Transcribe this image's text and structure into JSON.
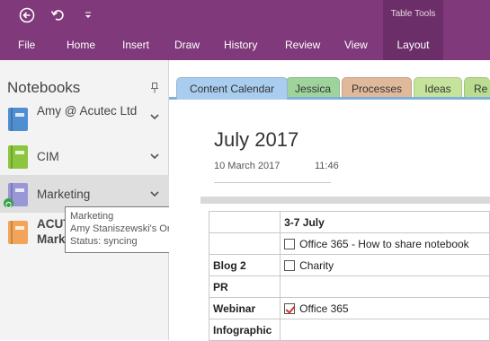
{
  "quick_access": {
    "back_icon": "back-circle-icon",
    "undo_icon": "undo-icon",
    "customize_icon": "customize-dropdown-icon"
  },
  "ribbon": {
    "color": "#80397b",
    "tabs": [
      {
        "label": "File"
      },
      {
        "label": "Home"
      },
      {
        "label": "Insert"
      },
      {
        "label": "Draw"
      },
      {
        "label": "History"
      },
      {
        "label": "Review"
      },
      {
        "label": "View"
      }
    ],
    "contextual_group": "Table Tools",
    "contextual_tab": "Layout"
  },
  "sidebar": {
    "header": "Notebooks",
    "pin_icon": "pin-icon",
    "notebooks": [
      {
        "label": "Amy @ Acutec Ltd",
        "color": "#4f8fd1"
      },
      {
        "label": "CIM",
        "color": "#8cc63e"
      },
      {
        "label": "Marketing",
        "color": "#9a97d9"
      },
      {
        "label": "ACUTEC Marketing",
        "color": "#f2a45a"
      }
    ],
    "tooltip": {
      "line1": "Marketing",
      "line2": "Amy Staniszewski's OneDrive » Documents",
      "line3": "Status: syncing"
    }
  },
  "section_tabs": [
    {
      "label": "Content Calendar",
      "color": "#a9cdee"
    },
    {
      "label": "Jessica",
      "color": "#9ed49c"
    },
    {
      "label": "Processes",
      "color": "#e0b99b"
    },
    {
      "label": "Ideas",
      "color": "#c5e39a"
    },
    {
      "label": "Re",
      "color": "#b9dc91"
    }
  ],
  "page": {
    "title": "July 2017",
    "date": "10 March 2017",
    "time": "11:46",
    "table": {
      "rows": [
        {
          "label": "",
          "value": "3-7 July",
          "bold_value": true,
          "checkbox": "none"
        },
        {
          "label": "",
          "value": "Office 365 - How to share notebook",
          "checkbox": "unchecked"
        },
        {
          "label": "Blog 2",
          "value": "Charity",
          "checkbox": "unchecked"
        },
        {
          "label": "PR",
          "value": "",
          "checkbox": "none"
        },
        {
          "label": "Webinar",
          "value": "Office 365",
          "checkbox": "checked"
        },
        {
          "label": "Infographic",
          "value": "",
          "checkbox": "none"
        }
      ]
    }
  }
}
